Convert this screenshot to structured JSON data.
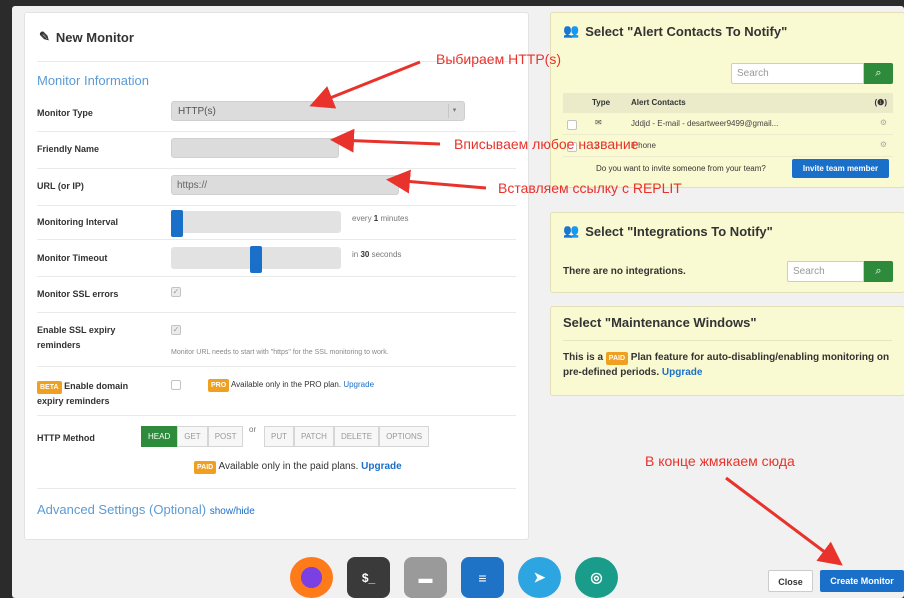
{
  "left": {
    "title": "New Monitor",
    "section_title": "Monitor Information",
    "monitor_type": {
      "label": "Monitor Type",
      "value": "HTTP(s)"
    },
    "friendly_name": {
      "label": "Friendly Name",
      "value": ""
    },
    "url": {
      "label": "URL (or IP)",
      "value": "https://"
    },
    "interval": {
      "label": "Monitoring Interval",
      "hint_prefix": "every",
      "hint_value": "1",
      "hint_suffix": "minutes",
      "level": 0.0
    },
    "timeout": {
      "label": "Monitor Timeout",
      "hint_prefix": "in",
      "hint_value": "30",
      "hint_suffix": "seconds",
      "level": 0.5
    },
    "ssl_errors": {
      "label": "Monitor SSL errors",
      "checked": true
    },
    "ssl_expiry": {
      "label_line1": "Enable SSL expiry",
      "label_line2": "reminders",
      "checked": true,
      "note": "Monitor URL needs to start with \"https\" for the SSL monitoring to work."
    },
    "domain_expiry": {
      "beta_badge": "BETA",
      "label_line1": "Enable domain",
      "label_line2": "expiry reminders",
      "pro_badge": "PRO",
      "pro_text": "Available only in the PRO plan.",
      "upgrade": "Upgrade"
    },
    "http_method": {
      "label": "HTTP Method",
      "group1": [
        "HEAD",
        "GET",
        "POST"
      ],
      "or": "or",
      "group2": [
        "PUT",
        "PATCH",
        "DELETE",
        "OPTIONS"
      ],
      "active": "HEAD"
    },
    "paid_note": {
      "badge": "PAID",
      "text": "Available only in the paid plans.",
      "upgrade": "Upgrade"
    },
    "advanced": {
      "title": "Advanced Settings (Optional)",
      "toggle": "show/hide"
    }
  },
  "alert_contacts": {
    "title": "Select \"Alert Contacts To Notify\"",
    "search_placeholder": "Search",
    "columns": {
      "type": "Type",
      "name": "Alert Contacts",
      "info": "(❶)"
    },
    "rows": [
      {
        "name": "Jddjd - E-mail - desartweer9499@gmail...",
        "icon": "envelope-icon"
      },
      {
        "name": "iPhone",
        "icon": "phone-icon"
      }
    ],
    "invite_question": "Do you want to invite someone from your team?",
    "invite_button": "Invite team member"
  },
  "integrations": {
    "title": "Select \"Integrations To Notify\"",
    "empty_text": "There are no integrations.",
    "search_placeholder": "Search"
  },
  "maintenance": {
    "title": "Select \"Maintenance Windows\"",
    "text_prefix": "This is a",
    "badge": "PAID",
    "text_suffix": "Plan feature for auto-disabling/enabling monitoring on pre-defined periods.",
    "upgrade": "Upgrade"
  },
  "annotations": {
    "http": "Выбираем HTTP(s)",
    "name": "Вписываем любое название",
    "url": "Вставляем ссылку с REPLIT",
    "create": "В конце жмякаем сюда"
  },
  "footer": {
    "close": "Close",
    "create": "Create Monitor"
  },
  "dock": [
    "firefox-icon",
    "terminal-icon",
    "files-icon",
    "notes-icon",
    "telegram-icon",
    "camera-icon"
  ],
  "colors": {
    "accent": "#1a6fc9",
    "green": "#2e8b3c",
    "annotation": "#e8322b",
    "card": "#fafad2"
  }
}
